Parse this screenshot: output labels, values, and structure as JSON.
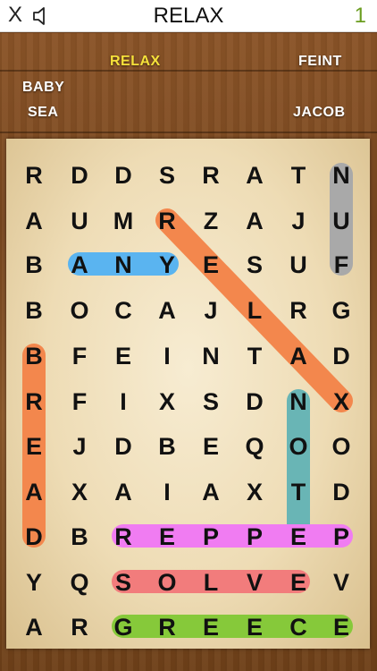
{
  "header": {
    "close_label": "X",
    "title": "RELAX",
    "counter": "1",
    "sound_icon": "speaker-muted-icon"
  },
  "words": {
    "current": "RELAX",
    "left": [
      "BABY",
      "SEA"
    ],
    "right": [
      "FEINT",
      "JACOB"
    ]
  },
  "grid": {
    "rows": [
      [
        "R",
        "D",
        "D",
        "S",
        "R",
        "A",
        "T",
        "N"
      ],
      [
        "A",
        "U",
        "M",
        "R",
        "Z",
        "A",
        "J",
        "U"
      ],
      [
        "B",
        "A",
        "N",
        "Y",
        "E",
        "S",
        "U",
        "F"
      ],
      [
        "B",
        "O",
        "C",
        "A",
        "J",
        "L",
        "R",
        "G"
      ],
      [
        "B",
        "F",
        "E",
        "I",
        "N",
        "T",
        "A",
        "D"
      ],
      [
        "R",
        "F",
        "I",
        "X",
        "S",
        "D",
        "N",
        "X"
      ],
      [
        "E",
        "J",
        "D",
        "B",
        "E",
        "Q",
        "O",
        "O"
      ],
      [
        "A",
        "X",
        "A",
        "I",
        "A",
        "X",
        "T",
        "D"
      ],
      [
        "D",
        "B",
        "R",
        "E",
        "P",
        "P",
        "E",
        "P"
      ],
      [
        "Y",
        "Q",
        "S",
        "O",
        "L",
        "V",
        "E",
        "V"
      ],
      [
        "A",
        "R",
        "G",
        "R",
        "E",
        "E",
        "C",
        "E"
      ]
    ]
  },
  "found": [
    {
      "from": [
        0,
        7
      ],
      "to": [
        2,
        7
      ],
      "color": "#a9a9a9"
    },
    {
      "from": [
        2,
        1
      ],
      "to": [
        2,
        3
      ],
      "color": "#5ab4f0"
    },
    {
      "from": [
        1,
        3
      ],
      "to": [
        5,
        7
      ],
      "color": "#f3874d"
    },
    {
      "from": [
        4,
        0
      ],
      "to": [
        8,
        0
      ],
      "color": "#f3874d"
    },
    {
      "from": [
        5,
        6
      ],
      "to": [
        8,
        6
      ],
      "color": "#69b5b5"
    },
    {
      "from": [
        8,
        2
      ],
      "to": [
        8,
        7
      ],
      "color": "#f07cf2"
    },
    {
      "from": [
        9,
        2
      ],
      "to": [
        9,
        6
      ],
      "color": "#f27c7c"
    },
    {
      "from": [
        10,
        2
      ],
      "to": [
        10,
        7
      ],
      "color": "#86c93a"
    }
  ],
  "colors": {
    "counter": "#6a9d1f",
    "current_word": "#f6e13a"
  }
}
